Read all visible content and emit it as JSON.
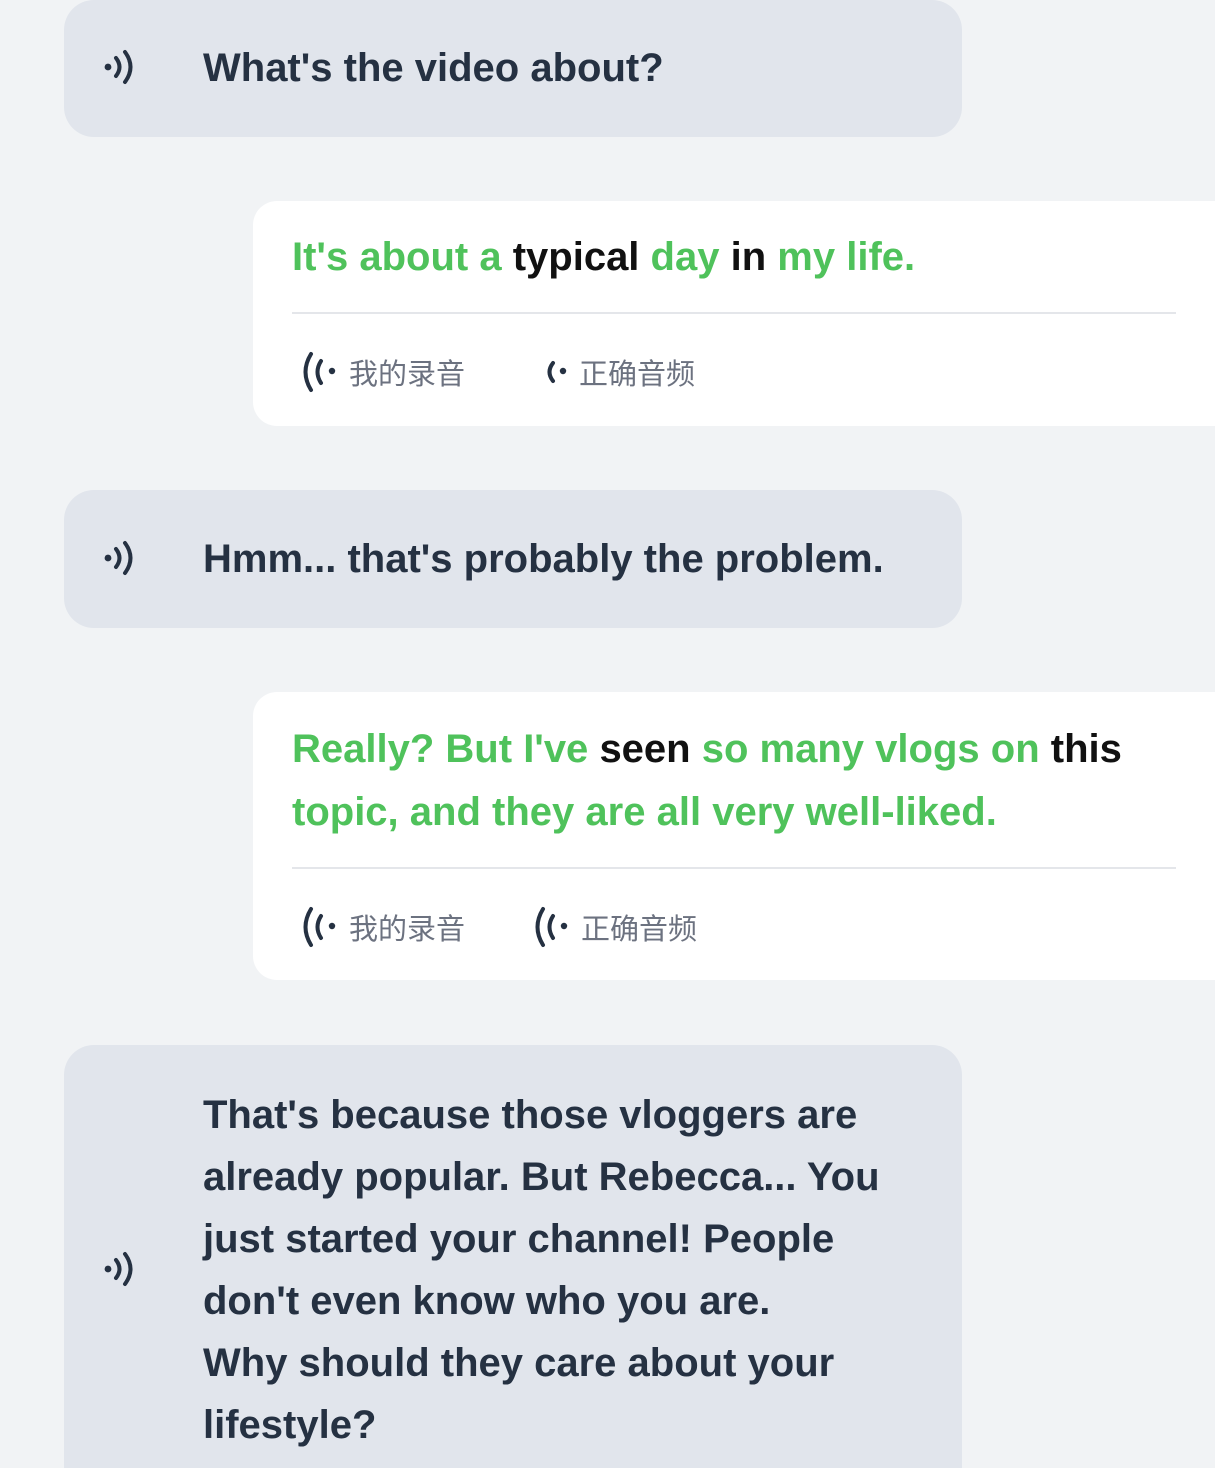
{
  "conversation": [
    {
      "role": "partner",
      "text": "What's the video about?"
    },
    {
      "role": "user",
      "words": [
        {
          "t": "It's",
          "ok": true
        },
        {
          "t": "about",
          "ok": true
        },
        {
          "t": "a",
          "ok": true
        },
        {
          "t": "typical",
          "ok": false
        },
        {
          "t": "day",
          "ok": true
        },
        {
          "t": "in",
          "ok": false
        },
        {
          "t": "my",
          "ok": true
        },
        {
          "t": "life.",
          "ok": true
        }
      ],
      "my_recording_label": "我的录音",
      "correct_audio_label": "正确音频"
    },
    {
      "role": "partner",
      "text": "Hmm... that's probably the problem."
    },
    {
      "role": "user",
      "words": [
        {
          "t": "Really?",
          "ok": true
        },
        {
          "t": "But",
          "ok": true
        },
        {
          "t": "I've",
          "ok": true
        },
        {
          "t": "seen",
          "ok": false
        },
        {
          "t": "so",
          "ok": true
        },
        {
          "t": "many",
          "ok": true
        },
        {
          "t": "vlogs",
          "ok": true
        },
        {
          "t": "on",
          "ok": true
        },
        {
          "t": "this",
          "ok": false
        },
        {
          "t": "topic,",
          "ok": true
        },
        {
          "t": "and",
          "ok": true
        },
        {
          "t": "they",
          "ok": true
        },
        {
          "t": "are",
          "ok": true
        },
        {
          "t": "all",
          "ok": true
        },
        {
          "t": "very",
          "ok": true
        },
        {
          "t": "well-liked.",
          "ok": true
        }
      ],
      "my_recording_label": "我的录音",
      "correct_audio_label": "正确音频"
    },
    {
      "role": "partner",
      "lines": [
        "That's because those vloggers are",
        "already popular. But Rebecca... You",
        "just started your channel! People",
        "don't even know who you are.",
        "Why should they care about your",
        "lifestyle?"
      ]
    }
  ],
  "colors": {
    "correct_word": "#4fc25b",
    "incorrect_word": "#111111",
    "partner_bubble": "#e1e5ec",
    "user_bubble": "#ffffff",
    "background": "#f1f3f5"
  },
  "icons": {
    "partner_speaker": "speaker-wave-icon",
    "recording": "broadcast-icon",
    "correct_audio": "broadcast-icon"
  }
}
